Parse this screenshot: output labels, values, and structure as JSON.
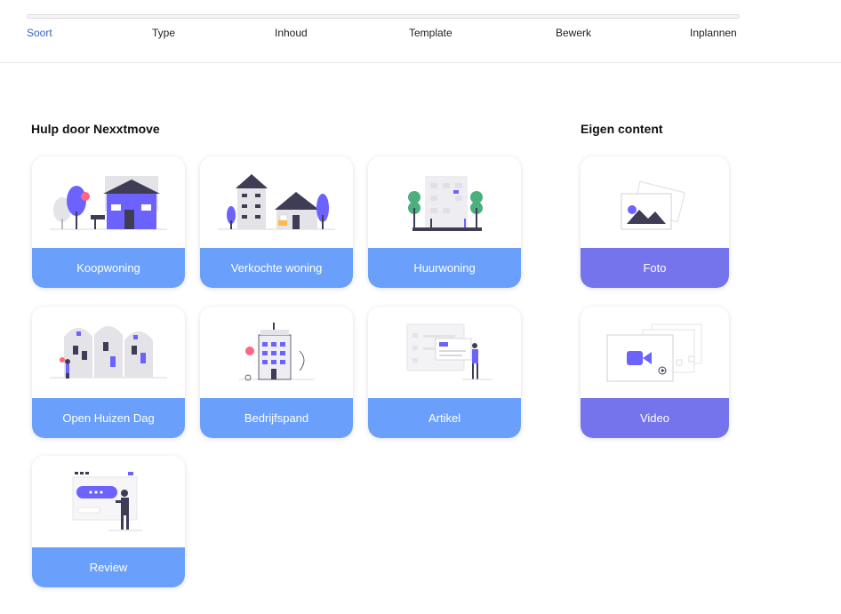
{
  "stepper": {
    "progress": 0.0,
    "steps": [
      {
        "label": "Soort",
        "active": true
      },
      {
        "label": "Type",
        "active": false
      },
      {
        "label": "Inhoud",
        "active": false
      },
      {
        "label": "Template",
        "active": false
      },
      {
        "label": "Bewerk",
        "active": false
      },
      {
        "label": "Inplannen",
        "active": false
      }
    ]
  },
  "help_section": {
    "title": "Hulp door Nexxtmove",
    "cards": [
      {
        "label": "Koopwoning",
        "icon": "house-illustration"
      },
      {
        "label": "Verkochte woning",
        "icon": "sold-houses-illustration"
      },
      {
        "label": "Huurwoning",
        "icon": "rental-building-illustration"
      },
      {
        "label": "Open Huizen Dag",
        "icon": "open-house-illustration"
      },
      {
        "label": "Bedrijfspand",
        "icon": "office-building-illustration"
      },
      {
        "label": "Artikel",
        "icon": "article-illustration"
      },
      {
        "label": "Review",
        "icon": "review-illustration"
      }
    ]
  },
  "own_section": {
    "title": "Eigen content",
    "cards": [
      {
        "label": "Foto",
        "icon": "photo-illustration"
      },
      {
        "label": "Video",
        "icon": "video-illustration"
      }
    ]
  },
  "colors": {
    "accent": "#3a63c8",
    "help_card_label": "#6aa0fb",
    "own_card_label": "#7574ec",
    "illustration_purple": "#6c63ff"
  }
}
